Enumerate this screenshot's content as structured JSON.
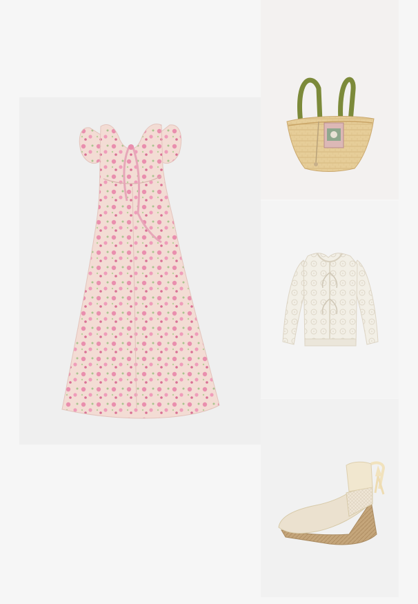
{
  "outfit": {
    "items": [
      {
        "id": "dress",
        "icon": "floral-midi-dress"
      },
      {
        "id": "bag",
        "icon": "straw-tote-bag"
      },
      {
        "id": "cardigan",
        "icon": "crochet-cardigan"
      },
      {
        "id": "shoe",
        "icon": "espadrille-wedge"
      }
    ]
  },
  "colors": {
    "page_background": "#f6f6f6",
    "dress_base": "#f3dcd4",
    "dress_print": "#e98fae",
    "straw": "#e6cd98",
    "bag_handle": "#7c8a3a",
    "cardigan": "#f2efe6",
    "shoe_canvas": "#ebe1cf",
    "jute": "#c4a57a"
  }
}
